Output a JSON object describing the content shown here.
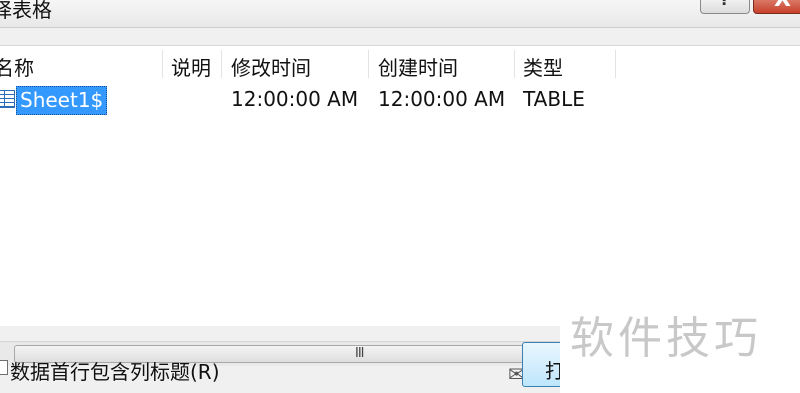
{
  "window": {
    "title": "择表格",
    "help_glyph": "?",
    "close_glyph": "X"
  },
  "list": {
    "columns": [
      "名称",
      "说明",
      "修改时间",
      "创建时间",
      "类型"
    ],
    "rows": [
      {
        "name": "Sheet1$",
        "description": "",
        "modified": "12:00:00 AM",
        "created": "12:00:00 AM",
        "type": "TABLE"
      }
    ]
  },
  "scrollbar": {
    "grip": "III"
  },
  "options": {
    "first_row_header_label": "数据首行包含列标题(R)"
  },
  "buttons": {
    "open_label": "打"
  },
  "icons": {
    "table": "table-icon",
    "wechat": "wechat-icon"
  },
  "watermark": {
    "text": "软件技巧"
  },
  "colors": {
    "selection": "#3399ff",
    "close": "#c7402b"
  }
}
